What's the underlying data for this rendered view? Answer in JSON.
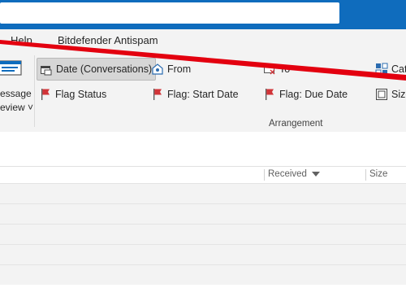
{
  "menu": {
    "help": "Help",
    "bitdefender": "Bitdefender Antispam"
  },
  "ribbon": {
    "message_preview": {
      "line1": "essage",
      "line2": "eview ˅"
    },
    "arrangement": {
      "date_conversations": "Date (Conversations)",
      "from": "From",
      "to": "To",
      "categories": "Cat",
      "flag_status": "Flag Status",
      "flag_start_date": "Flag: Start Date",
      "flag_due_date": "Flag: Due Date",
      "size": "Size",
      "group_label": "Arrangement"
    }
  },
  "list": {
    "col_received": "Received",
    "col_size": "Size"
  },
  "colors": {
    "titlebar": "#0f6cbd",
    "flag_red": "#d13438",
    "annotation_red": "#e3000f"
  }
}
